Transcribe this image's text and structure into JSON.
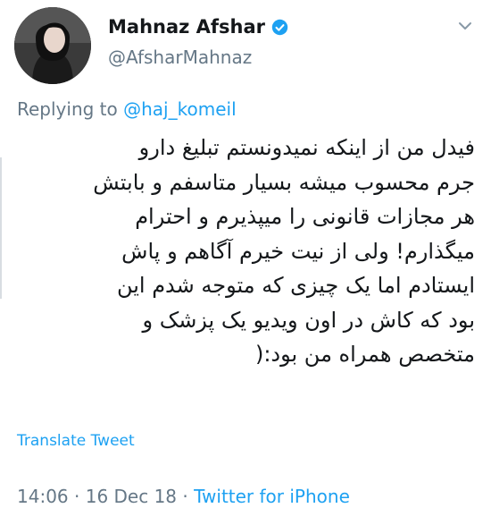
{
  "author": {
    "name": "Mahnaz Afshar",
    "handle": "@AfsharMahnaz",
    "verified": true,
    "avatar_icon": "profile-photo"
  },
  "reply": {
    "prefix": "Replying to",
    "to_handle": "@haj_komeil"
  },
  "tweet": {
    "lines": [
      "فیدل من از اینکه نمیدونستم تبلیغ دارو",
      "جرم محسوب میشه بسیار متاسفم و بابتش",
      "هر مجازات قانونی را میپذیرم و احترام",
      "میگذارم! ولی از نیت خیرم آگاهم و پاش",
      "ایستادم اما یک چیزی که متوجه شدم این",
      "بود که کاش در اون ویدیو یک پزشک و",
      "متخصص همراه من بود:("
    ]
  },
  "translate_label": "Translate Tweet",
  "meta": {
    "time": "14:06",
    "sep1": " · ",
    "date": "16 Dec 18",
    "sep2": " · ",
    "source": "Twitter for iPhone"
  },
  "colors": {
    "link": "#1da1f2",
    "muted": "#657786",
    "text": "#14171a"
  }
}
